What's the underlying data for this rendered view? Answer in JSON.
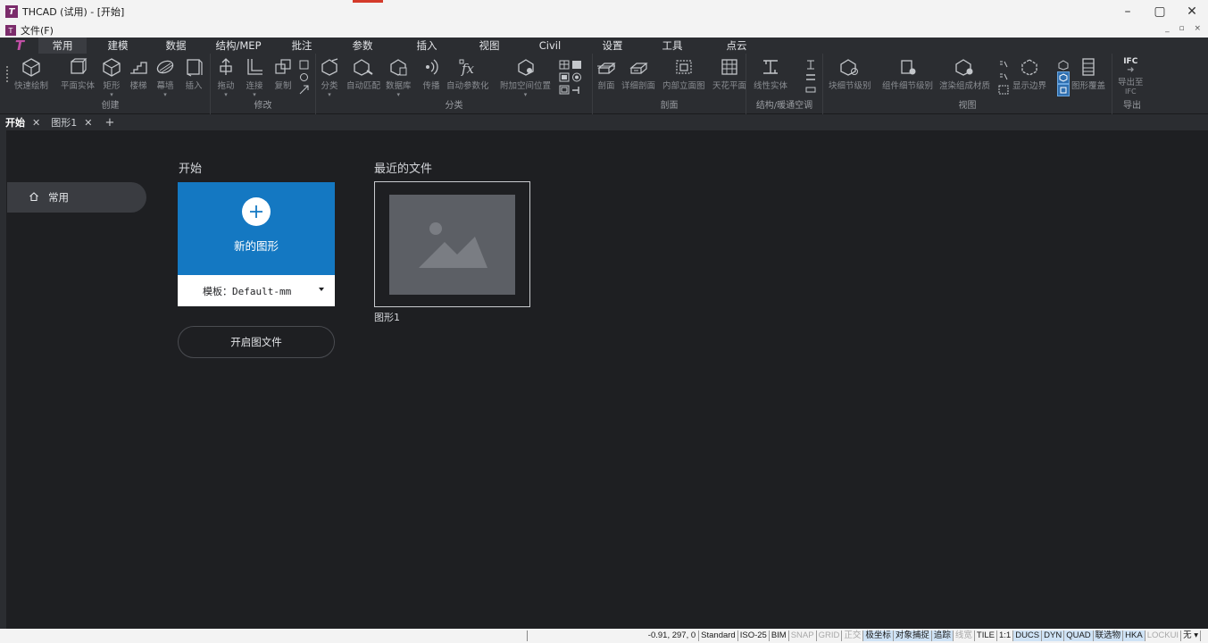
{
  "window": {
    "title": "THCAD (试用) - [开始]",
    "app_icon": "T",
    "controls": [
      "–",
      "▢",
      "✕"
    ]
  },
  "menubar": {
    "file_menu": "文件(F)",
    "mdi_controls": "_ ▫ ×"
  },
  "ribbon_tabs": [
    "常用",
    "建模",
    "数据",
    "结构/MEP",
    "批注",
    "参数",
    "插入",
    "视图",
    "Civil",
    "设置",
    "工具",
    "点云"
  ],
  "ribbon_groups": {
    "create": {
      "title": "创建",
      "tools": [
        "快速绘制",
        "平面实体",
        "矩形",
        "楼梯",
        "幕墙",
        "插入"
      ]
    },
    "modify": {
      "title": "修改",
      "tools": [
        "拖动",
        "连接",
        "复制"
      ]
    },
    "classify": {
      "title": "分类",
      "tools": [
        "分类",
        "自动匹配",
        "数据库",
        "传播",
        "自动参数化",
        "附加空间位置"
      ]
    },
    "section": {
      "title": "剖面",
      "tools": [
        "剖面",
        "详细剖面",
        "内部立面图",
        "天花平面"
      ]
    },
    "hvac": {
      "title": "结构/暖通空调",
      "tools": [
        "线性实体"
      ]
    },
    "view": {
      "title": "视图",
      "tools": [
        "块细节级别",
        "组件细节级别",
        "渲染组成材质",
        "显示边界",
        "图形覆盖"
      ]
    },
    "export": {
      "title": "导出",
      "tools": [
        "导出至",
        "IFC"
      ],
      "badge": "IFC"
    }
  },
  "doc_tabs": [
    {
      "label": "开始",
      "close": "✕"
    },
    {
      "label": "图形1",
      "close": "✕"
    }
  ],
  "doc_tabs_add": "+",
  "sidebar": {
    "items": [
      {
        "label": "常用",
        "icon": "home-icon"
      }
    ]
  },
  "start": {
    "title": "开始",
    "new_drawing": "新的图形",
    "template_label": "模板：Default-mm",
    "open_file": "开启图文件"
  },
  "recent": {
    "title": "最近的文件",
    "files": [
      {
        "name": "图形1"
      }
    ]
  },
  "statusbar": {
    "coords": "-0.91, 297, 0",
    "items": [
      {
        "label": "Standard",
        "state": "on"
      },
      {
        "label": "ISO-25",
        "state": "on"
      },
      {
        "label": "BIM",
        "state": "on"
      },
      {
        "label": "SNAP",
        "state": "off"
      },
      {
        "label": "GRID",
        "state": "off"
      },
      {
        "label": "正交",
        "state": "off"
      },
      {
        "label": "极坐标",
        "state": "hl"
      },
      {
        "label": "对象捕捉",
        "state": "hl"
      },
      {
        "label": "追踪",
        "state": "hl"
      },
      {
        "label": "线宽",
        "state": "off"
      },
      {
        "label": "TILE",
        "state": "on"
      },
      {
        "label": "1:1",
        "state": "on"
      },
      {
        "label": "DUCS",
        "state": "hl"
      },
      {
        "label": "DYN",
        "state": "hl"
      },
      {
        "label": "QUAD",
        "state": "hl"
      },
      {
        "label": "联选物",
        "state": "hl"
      },
      {
        "label": "HKA",
        "state": "hl"
      },
      {
        "label": "LOCKUI",
        "state": "off"
      },
      {
        "label": "无 ▾",
        "state": "on"
      }
    ]
  },
  "colors": {
    "accent": "#1478c2",
    "background": "#1e1f22",
    "panel": "#2b2d31"
  }
}
